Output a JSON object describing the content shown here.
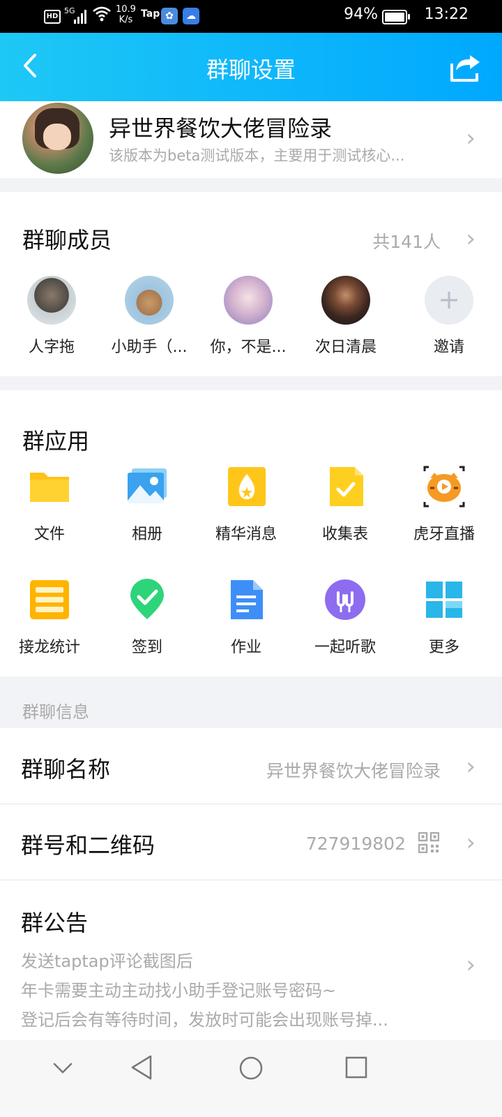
{
  "status_bar": {
    "hd": "HD",
    "network": "5G",
    "speed_value": "10.9",
    "speed_unit": "K/s",
    "tap_label": "Tap",
    "battery": "94%",
    "time": "13:22"
  },
  "header": {
    "title": "群聊设置",
    "back_icon": "chevron-left-icon",
    "share_icon": "share-icon"
  },
  "group": {
    "name": "异世界餐饮大佬冒险录",
    "description": "该版本为beta测试版本，主要用于测试核心..."
  },
  "members": {
    "title": "群聊成员",
    "count": "共141人",
    "list": [
      {
        "name": "人字拖"
      },
      {
        "name": "小助手（..."
      },
      {
        "name": "你，不是..."
      },
      {
        "name": "次日清晨"
      }
    ],
    "invite_label": "邀请"
  },
  "apps": {
    "title": "群应用",
    "items": [
      {
        "label": "文件",
        "icon": "folder-icon"
      },
      {
        "label": "相册",
        "icon": "photo-album-icon"
      },
      {
        "label": "精华消息",
        "icon": "essence-icon"
      },
      {
        "label": "收集表",
        "icon": "form-icon"
      },
      {
        "label": "虎牙直播",
        "icon": "huya-icon"
      },
      {
        "label": "接龙统计",
        "icon": "list-icon"
      },
      {
        "label": "签到",
        "icon": "check-in-icon"
      },
      {
        "label": "作业",
        "icon": "homework-icon"
      },
      {
        "label": "一起听歌",
        "icon": "headphones-icon"
      },
      {
        "label": "更多",
        "icon": "grid-icon"
      }
    ]
  },
  "info": {
    "section_label": "群聊信息",
    "name_label": "群聊名称",
    "name_value": "异世界餐饮大佬冒险录",
    "id_label": "群号和二维码",
    "id_value": "727919802",
    "notice_label": "群公告",
    "notice_lines": [
      "发送taptap评论截图后",
      "年卡需要主动主动找小助手登记账号密码~",
      "登记后会有等待时间，发放时可能会出现账号掉..."
    ]
  },
  "nav": {
    "down": "chevron-down-icon",
    "back": "back-triangle-icon",
    "home": "home-circle-icon",
    "recent": "recent-square-icon"
  }
}
